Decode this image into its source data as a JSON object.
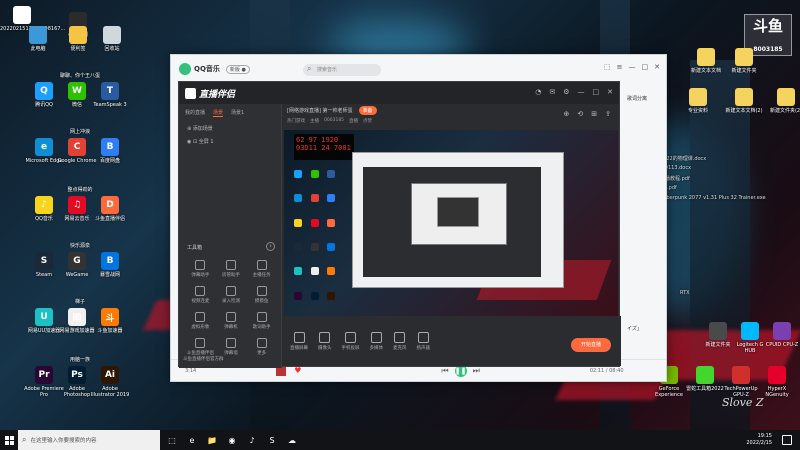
{
  "desktop_left": {
    "top_icons": [
      {
        "label": "2022021512062898167...",
        "color": "#ffffff",
        "icon": "document-icon"
      },
      {
        "label": "小鹿特别",
        "color": "#2b2b2b",
        "icon": "folder-icon"
      },
      {
        "label": "此电脑",
        "color": "#3a9ad9",
        "icon": "computer-icon"
      },
      {
        "label": "便利签",
        "color": "#f4c542",
        "icon": "note-icon"
      },
      {
        "label": "回收站",
        "color": "#cfd8dc",
        "icon": "recycle-bin-icon"
      }
    ],
    "groups": [
      {
        "title": "聊聊、你个王八蛋",
        "icons": [
          {
            "label": "腾讯QQ",
            "color": "#1aa0ff",
            "glyph": "Q"
          },
          {
            "label": "微信",
            "color": "#2dc100",
            "glyph": "W"
          },
          {
            "label": "TeamSpeak 3",
            "color": "#2c5aa0",
            "glyph": "T"
          }
        ]
      },
      {
        "title": "网上冲浪",
        "icons": [
          {
            "label": "Microsoft Edge",
            "color": "#0f8ed8",
            "glyph": "e"
          },
          {
            "label": "Google Chrome",
            "color": "#e34133",
            "glyph": "C"
          },
          {
            "label": "百度网盘",
            "color": "#2f7ef5",
            "glyph": "B"
          }
        ]
      },
      {
        "title": "整点得劲的",
        "icons": [
          {
            "label": "QQ音乐",
            "color": "#f8d41a",
            "glyph": "♪"
          },
          {
            "label": "网易云音乐",
            "color": "#e20b23",
            "glyph": "♫"
          },
          {
            "label": "斗鱼直播伴侣",
            "color": "#ff6a3d",
            "glyph": "D"
          }
        ]
      },
      {
        "title": "快乐源泉",
        "icons": [
          {
            "label": "Steam",
            "color": "#1b2838",
            "glyph": "S"
          },
          {
            "label": "WeGame",
            "color": "#333333",
            "glyph": "G"
          },
          {
            "label": "暴雪战网",
            "color": "#0074e0",
            "glyph": "B"
          }
        ]
      },
      {
        "title": "梯子",
        "icons": [
          {
            "label": "网易UU加速器",
            "color": "#1cc2c2",
            "glyph": "U"
          },
          {
            "label": "网易游戏加速器",
            "color": "#f0f0f0",
            "glyph": "网"
          },
          {
            "label": "斗鱼加速器",
            "color": "#ff7a00",
            "glyph": "斗"
          }
        ]
      },
      {
        "title": "用脑一族",
        "icons": [
          {
            "label": "Adobe Premiere Pro",
            "color": "#2a0634",
            "glyph": "Pr"
          },
          {
            "label": "Adobe Photoshop",
            "color": "#001d34",
            "glyph": "Ps"
          },
          {
            "label": "Adobe Illustrator 2019",
            "color": "#2e1600",
            "glyph": "Ai"
          }
        ]
      }
    ]
  },
  "qq_music": {
    "name": "QQ音乐",
    "version": "新版 ●",
    "search_placeholder": "搜索音乐",
    "controls": [
      "⬚",
      "≡",
      "—",
      "□",
      "✕"
    ],
    "right_text_1": "歌词分离",
    "right_text_2": "イズ」",
    "time": "3:14",
    "progress_time": "02:11 / 08:40"
  },
  "live": {
    "brand": "直播伴侣",
    "top_icons": [
      "◔",
      "✉",
      "⚙",
      "—",
      "□",
      "✕"
    ],
    "tabs": [
      "我的直播",
      "场景",
      "场景1"
    ],
    "scene_rows": [
      "⊕ 添加场景",
      "◉ ⊡ 全屏 1"
    ],
    "title_text": "[网络游戏直播] 第一帅老师蛋",
    "status": "准备",
    "info": [
      "热门游戏",
      "主播",
      "0003185",
      "直播",
      "点赞"
    ],
    "right_icons": [
      "⊕",
      "⟲",
      "⊞",
      "⇪"
    ],
    "tool_title": "工具箱",
    "tools": [
      "弹幕助手",
      "房管助手",
      "主播任务",
      "视频连麦",
      "录入检测",
      "摸摸鱼",
      "虚拟形象",
      "弹幕机",
      "歌词助手",
      "斗鱼直播伴侣",
      "弹幕墙",
      "更多"
    ],
    "bottom_items": [
      "直播屏幕",
      "摄像头",
      "手机投屏",
      "多媒体",
      "麦克风",
      "扬声器"
    ],
    "start_button": "开始直播",
    "foot_text": "斗鱼直播伴侣官方群"
  },
  "desktop_right": {
    "watermark_big": "斗鱼",
    "watermark_num": "8003185",
    "files": [
      "新建文本文档",
      "新建文件夹",
      "专业资料",
      "新建文本文档(2)",
      "新建文件夹(2)",
      "2022的物理课.docx",
      "...0113.docx",
      "直播教程.pdf",
      "(1).pdf",
      "Cyberpunk 2077 v1.31 Plus 32 Trainer.exe"
    ],
    "bottom_icons": [
      {
        "label": "GeForce Experience",
        "color": "#76b900"
      },
      {
        "label": "雷蛇工具箱2022",
        "color": "#44d62c"
      },
      {
        "label": "TechPowerUp GPU-Z",
        "color": "#d12e2e"
      },
      {
        "label": "HyperX NGenuity",
        "color": "#e4002b"
      }
    ],
    "mid_icons": [
      {
        "label": "新建文件夹",
        "color": "#4a4a4a"
      },
      {
        "label": "Logitech G HUB",
        "color": "#00b8fc"
      },
      {
        "label": "CPUID CPU-Z",
        "color": "#7a3fb0"
      }
    ],
    "left_col_label": "RTX"
  },
  "taskbar": {
    "search_placeholder": "在这里输入你要搜索的内容",
    "apps": [
      "⬚",
      "e",
      "📁",
      "◉",
      "♪",
      "S",
      "☁"
    ],
    "time": "19:15",
    "date": "2022/2/15"
  },
  "signature": "Slove Z"
}
